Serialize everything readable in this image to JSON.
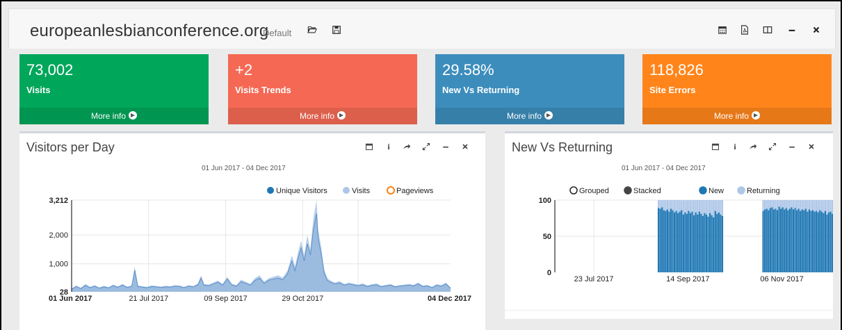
{
  "header": {
    "title": "europeanlesbianconference.org",
    "profile": "Default",
    "icons": [
      "folder-open-icon",
      "save-icon",
      "calendar-icon",
      "pdf-icon",
      "columns-icon",
      "minimize-icon",
      "close-icon"
    ]
  },
  "stats": [
    {
      "value": "73,002",
      "label": "Visits",
      "more": "More info",
      "color": "#00a65a"
    },
    {
      "value": "+2",
      "label": "Visits Trends",
      "more": "More info",
      "color": "#f56954"
    },
    {
      "value": "29.58%",
      "label": "New Vs Returning",
      "more": "More info",
      "color": "#3c8dbc"
    },
    {
      "value": "118,826",
      "label": "Site Errors",
      "more": "More info",
      "color": "#ff851b"
    }
  ],
  "panels": {
    "visitors": {
      "title": "Visitors per Day",
      "date_range": "01 Jun 2017 - 04 Dec 2017",
      "tools": [
        "calendar-icon",
        "info-icon",
        "share-icon",
        "expand-icon",
        "minimize-icon",
        "close-icon"
      ]
    },
    "newret": {
      "title": "New Vs Returning",
      "date_range": "01 Jun 2017 - 04 Dec 2017",
      "tools": [
        "calendar-icon",
        "info-icon",
        "share-icon",
        "expand-icon",
        "minimize-icon",
        "close-icon"
      ]
    }
  },
  "chart_data": [
    {
      "type": "area",
      "legend": [
        "Unique Visitors",
        "Visits",
        "Pageviews"
      ],
      "legend_placement": "top-right",
      "colors": {
        "unique": "#1f77b4",
        "visits": "#aec7e8",
        "pageviews": "#ff7f0e"
      },
      "y_ticks": [
        "3,212",
        "2,000",
        "1,000",
        "28"
      ],
      "ylim": [
        28,
        3212
      ],
      "x_ticks": [
        "01 Jun 2017",
        "21 Jul 2017",
        "09 Sep 2017",
        "29 Oct 2017",
        "04 Dec 2017"
      ],
      "grid": true,
      "series_visits": [
        [
          0,
          140
        ],
        [
          3,
          250
        ],
        [
          6,
          170
        ],
        [
          9,
          300
        ],
        [
          12,
          200
        ],
        [
          15,
          260
        ],
        [
          18,
          180
        ],
        [
          21,
          240
        ],
        [
          24,
          190
        ],
        [
          27,
          280
        ],
        [
          30,
          220
        ],
        [
          33,
          300
        ],
        [
          36,
          210
        ],
        [
          39,
          250
        ],
        [
          41,
          900
        ],
        [
          43,
          250
        ],
        [
          46,
          220
        ],
        [
          49,
          200
        ],
        [
          52,
          250
        ],
        [
          55,
          230
        ],
        [
          58,
          210
        ],
        [
          61,
          240
        ],
        [
          64,
          220
        ],
        [
          67,
          260
        ],
        [
          70,
          250
        ],
        [
          73,
          200
        ],
        [
          76,
          260
        ],
        [
          79,
          230
        ],
        [
          82,
          320
        ],
        [
          84,
          600
        ],
        [
          86,
          300
        ],
        [
          89,
          280
        ],
        [
          92,
          350
        ],
        [
          95,
          420
        ],
        [
          98,
          300
        ],
        [
          101,
          550
        ],
        [
          104,
          310
        ],
        [
          107,
          260
        ],
        [
          110,
          450
        ],
        [
          113,
          380
        ],
        [
          116,
          300
        ],
        [
          119,
          500
        ],
        [
          122,
          600
        ],
        [
          125,
          380
        ],
        [
          128,
          500
        ],
        [
          131,
          550
        ],
        [
          134,
          600
        ],
        [
          137,
          520
        ],
        [
          140,
          750
        ],
        [
          143,
          1300
        ],
        [
          145,
          900
        ],
        [
          147,
          1400
        ],
        [
          149,
          1800
        ],
        [
          151,
          1300
        ],
        [
          153,
          2000
        ],
        [
          155,
          1500
        ],
        [
          157,
          2600
        ],
        [
          159,
          3212
        ],
        [
          160,
          2200
        ],
        [
          162,
          1600
        ],
        [
          164,
          800
        ],
        [
          166,
          500
        ],
        [
          168,
          420
        ],
        [
          171,
          350
        ],
        [
          174,
          400
        ],
        [
          177,
          300
        ],
        [
          180,
          350
        ],
        [
          183,
          310
        ],
        [
          186,
          280
        ],
        [
          189,
          320
        ],
        [
          192,
          250
        ],
        [
          195,
          290
        ],
        [
          198,
          320
        ],
        [
          201,
          240
        ],
        [
          204,
          270
        ],
        [
          207,
          300
        ],
        [
          210,
          230
        ],
        [
          213,
          260
        ],
        [
          216,
          280
        ],
        [
          219,
          300
        ],
        [
          222,
          270
        ],
        [
          225,
          350
        ],
        [
          228,
          250
        ],
        [
          231,
          270
        ],
        [
          234,
          200
        ],
        [
          237,
          300
        ],
        [
          240,
          260
        ],
        [
          243,
          350
        ],
        [
          246,
          180
        ]
      ],
      "series_unique": [
        [
          0,
          120
        ],
        [
          3,
          210
        ],
        [
          6,
          140
        ],
        [
          9,
          250
        ],
        [
          12,
          170
        ],
        [
          15,
          220
        ],
        [
          18,
          150
        ],
        [
          21,
          200
        ],
        [
          24,
          160
        ],
        [
          27,
          240
        ],
        [
          30,
          180
        ],
        [
          33,
          260
        ],
        [
          36,
          180
        ],
        [
          39,
          210
        ],
        [
          41,
          780
        ],
        [
          43,
          210
        ],
        [
          46,
          190
        ],
        [
          49,
          170
        ],
        [
          52,
          210
        ],
        [
          55,
          200
        ],
        [
          58,
          180
        ],
        [
          61,
          200
        ],
        [
          64,
          190
        ],
        [
          67,
          220
        ],
        [
          70,
          210
        ],
        [
          73,
          170
        ],
        [
          76,
          220
        ],
        [
          79,
          200
        ],
        [
          82,
          270
        ],
        [
          84,
          500
        ],
        [
          86,
          260
        ],
        [
          89,
          240
        ],
        [
          92,
          300
        ],
        [
          95,
          360
        ],
        [
          98,
          260
        ],
        [
          101,
          470
        ],
        [
          104,
          270
        ],
        [
          107,
          220
        ],
        [
          110,
          380
        ],
        [
          113,
          320
        ],
        [
          116,
          260
        ],
        [
          119,
          420
        ],
        [
          122,
          500
        ],
        [
          125,
          320
        ],
        [
          128,
          430
        ],
        [
          131,
          470
        ],
        [
          134,
          500
        ],
        [
          137,
          440
        ],
        [
          140,
          640
        ],
        [
          143,
          1100
        ],
        [
          145,
          760
        ],
        [
          147,
          1200
        ],
        [
          149,
          1550
        ],
        [
          151,
          1100
        ],
        [
          153,
          1700
        ],
        [
          155,
          1300
        ],
        [
          157,
          2200
        ],
        [
          159,
          2750
        ],
        [
          160,
          1900
        ],
        [
          162,
          1350
        ],
        [
          164,
          680
        ],
        [
          166,
          420
        ],
        [
          168,
          360
        ],
        [
          171,
          300
        ],
        [
          174,
          340
        ],
        [
          177,
          260
        ],
        [
          180,
          300
        ],
        [
          183,
          270
        ],
        [
          186,
          240
        ],
        [
          189,
          270
        ],
        [
          192,
          210
        ],
        [
          195,
          250
        ],
        [
          198,
          270
        ],
        [
          201,
          200
        ],
        [
          204,
          230
        ],
        [
          207,
          260
        ],
        [
          210,
          200
        ],
        [
          213,
          220
        ],
        [
          216,
          240
        ],
        [
          219,
          260
        ],
        [
          222,
          230
        ],
        [
          225,
          300
        ],
        [
          228,
          210
        ],
        [
          231,
          230
        ],
        [
          234,
          170
        ],
        [
          237,
          250
        ],
        [
          240,
          220
        ],
        [
          243,
          300
        ],
        [
          246,
          150
        ]
      ]
    },
    {
      "type": "bar",
      "stacking": "stacked",
      "legend": [
        "Grouped",
        "Stacked",
        "New",
        "Returning"
      ],
      "legend_placement": "top",
      "colors": {
        "new": "#1f77b4",
        "returning": "#aec7e8"
      },
      "y_ticks": [
        "100",
        "50",
        "0"
      ],
      "ylim": [
        0,
        100
      ],
      "x_ticks": [
        "23 Jul 2017",
        "14 Sep 2017",
        "06 Nov 2017"
      ],
      "groups": [
        {
          "start": "2017-08-28",
          "new": [
            89,
            88,
            90,
            86,
            85,
            87,
            84,
            88,
            86,
            83,
            85,
            82,
            84,
            86,
            80,
            83,
            81,
            85,
            82,
            84,
            79,
            83,
            80,
            84,
            81,
            78,
            82,
            80,
            77,
            82,
            79,
            76,
            85,
            81,
            83,
            80,
            78
          ],
          "returning": [
            11,
            12,
            10,
            14,
            15,
            13,
            16,
            12,
            14,
            17,
            15,
            18,
            16,
            14,
            20,
            17,
            19,
            15,
            18,
            16,
            21,
            17,
            20,
            16,
            19,
            22,
            18,
            20,
            23,
            18,
            21,
            24,
            15,
            19,
            17,
            20,
            22
          ]
        },
        {
          "start": "2017-10-26",
          "new": [
            85,
            87,
            88,
            86,
            89,
            90,
            87,
            88,
            86,
            91,
            88,
            90,
            87,
            89,
            86,
            88,
            90,
            87,
            89,
            86,
            88,
            85,
            87,
            86,
            88,
            84,
            87,
            85,
            86,
            84,
            85,
            83,
            86,
            84,
            82,
            85,
            80,
            83,
            84,
            81,
            79,
            82,
            80,
            78,
            76
          ],
          "returning": [
            15,
            13,
            12,
            14,
            11,
            10,
            13,
            12,
            14,
            9,
            12,
            10,
            13,
            11,
            14,
            12,
            10,
            13,
            11,
            14,
            12,
            15,
            13,
            14,
            12,
            16,
            13,
            15,
            14,
            16,
            15,
            17,
            14,
            16,
            18,
            15,
            20,
            17,
            16,
            19,
            21,
            18,
            20,
            22,
            24
          ]
        }
      ]
    }
  ]
}
